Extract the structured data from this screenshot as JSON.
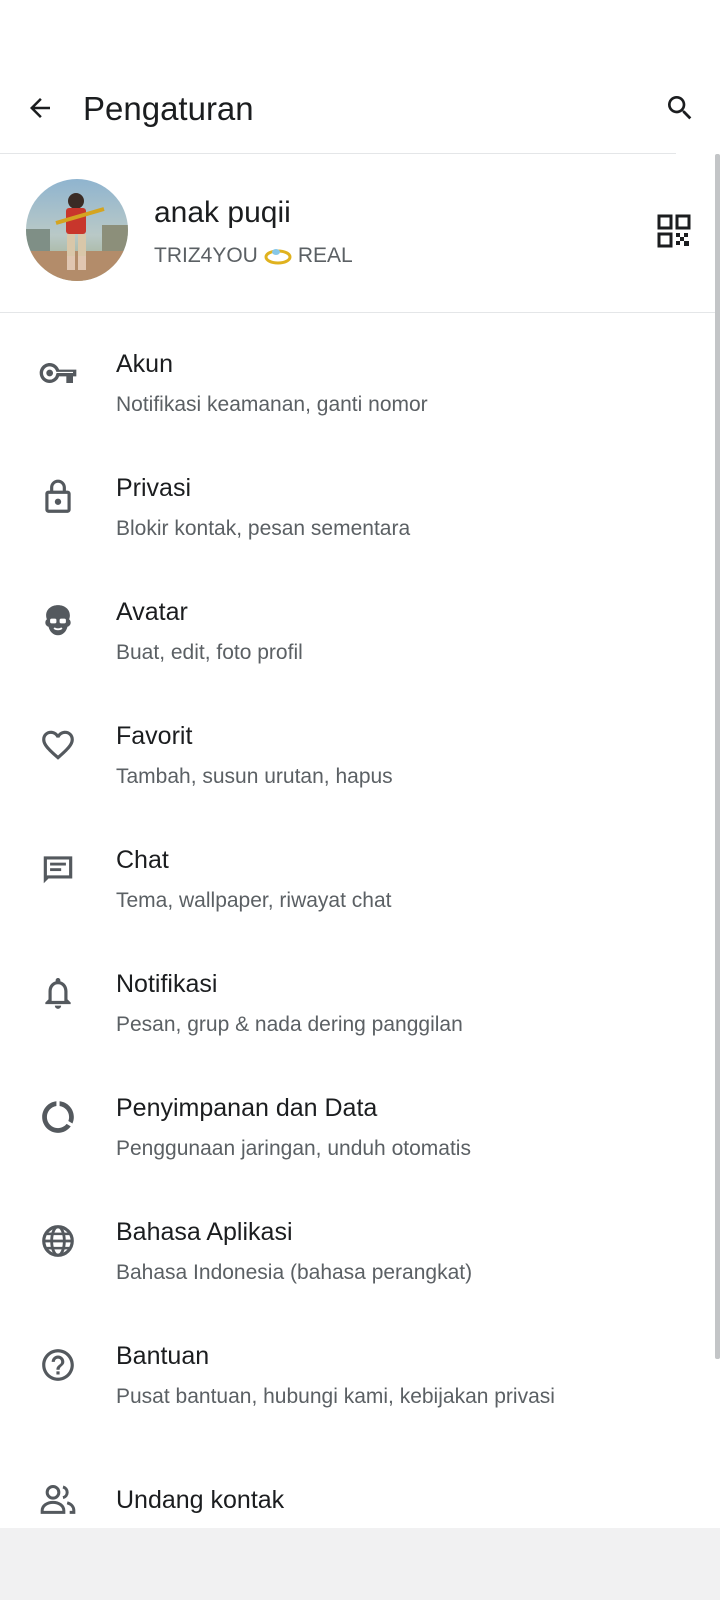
{
  "appbar": {
    "title": "Pengaturan",
    "back_icon": "arrow-left-icon",
    "search_icon": "search-icon"
  },
  "profile": {
    "name": "anak puqii",
    "about_prefix": "TRIZ4YOU",
    "about_suffix": "REAL",
    "about_emoji": "ring-emoji",
    "qr_icon": "qr-code-icon"
  },
  "menu": [
    {
      "id": "akun",
      "icon": "key-icon",
      "label": "Akun",
      "sub": "Notifikasi keamanan, ganti nomor"
    },
    {
      "id": "privasi",
      "icon": "lock-icon",
      "label": "Privasi",
      "sub": "Blokir kontak, pesan sementara"
    },
    {
      "id": "avatar",
      "icon": "avatar-face-icon",
      "label": "Avatar",
      "sub": "Buat, edit, foto profil"
    },
    {
      "id": "favorit",
      "icon": "heart-icon",
      "label": "Favorit",
      "sub": "Tambah, susun urutan, hapus"
    },
    {
      "id": "chat",
      "icon": "chat-icon",
      "label": "Chat",
      "sub": "Tema, wallpaper, riwayat chat"
    },
    {
      "id": "notifikasi",
      "icon": "bell-icon",
      "label": "Notifikasi",
      "sub": "Pesan, grup & nada dering panggilan"
    },
    {
      "id": "penyimpanan",
      "icon": "data-usage-icon",
      "label": "Penyimpanan dan Data",
      "sub": "Penggunaan jaringan, unduh otomatis"
    },
    {
      "id": "bahasa",
      "icon": "globe-icon",
      "label": "Bahasa Aplikasi",
      "sub": "Bahasa Indonesia (bahasa perangkat)"
    },
    {
      "id": "bantuan",
      "icon": "help-circle-icon",
      "label": "Bantuan",
      "sub": "Pusat bantuan, hubungi kami, kebijakan privasi"
    },
    {
      "id": "undang",
      "icon": "people-icon",
      "label": "Undang kontak",
      "sub": ""
    }
  ],
  "colors": {
    "text_primary": "#1b1d1f",
    "text_secondary": "#5b6064",
    "icon": "#54595e",
    "background": "#ffffff",
    "nav_area": "#f1f1f2"
  }
}
